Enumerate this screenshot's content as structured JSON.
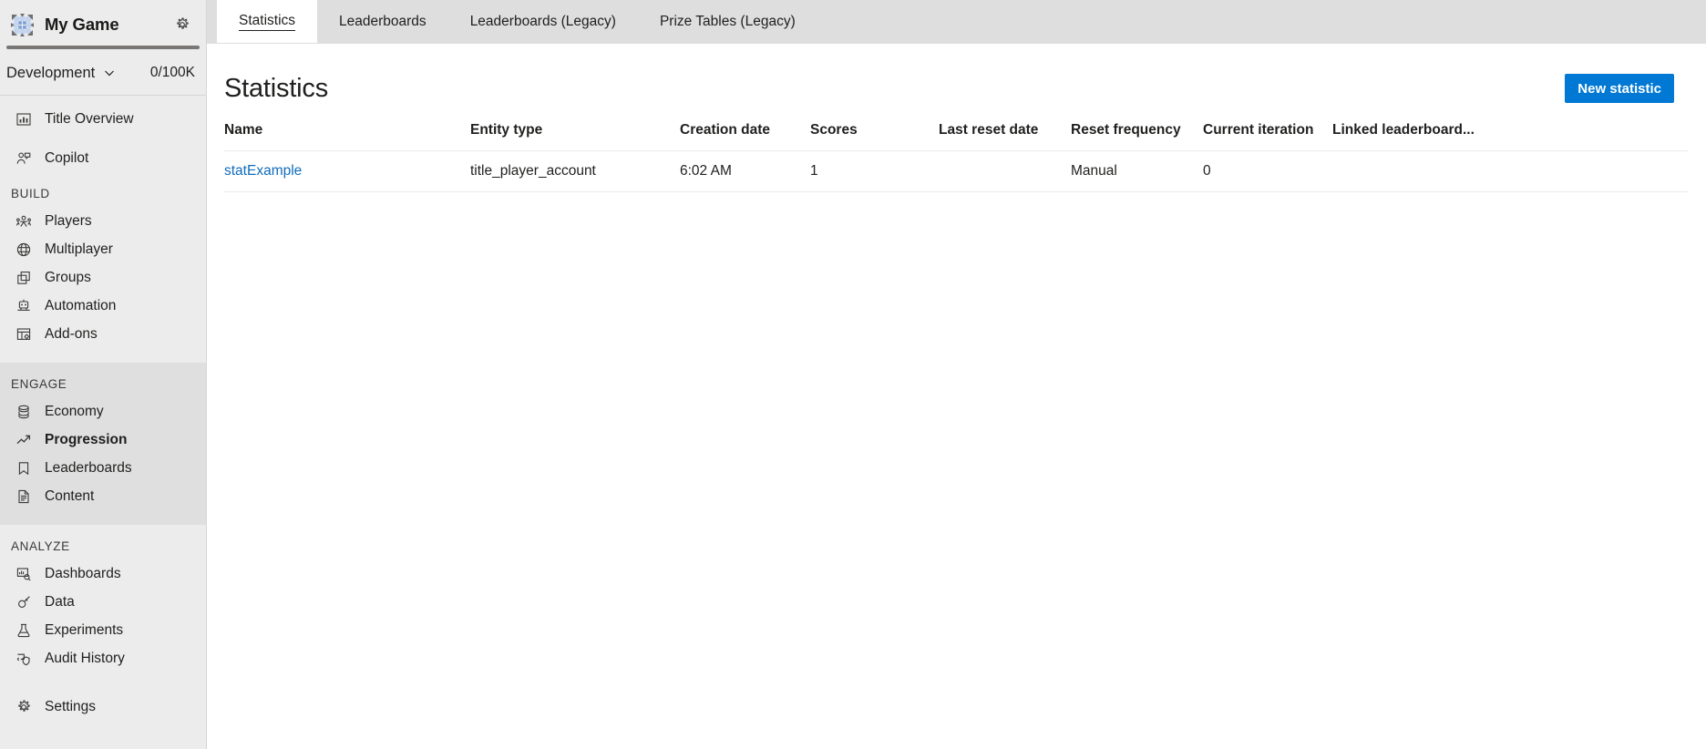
{
  "sidebar": {
    "logo_icon": "grid-logo-icon",
    "game_title": "My Game",
    "settings_icon": "gear-icon",
    "progress_percent": 0,
    "environment": {
      "name": "Development",
      "chevron_icon": "chevron-down-icon",
      "quota": "0/100K"
    },
    "top_items": [
      {
        "label": "Title Overview",
        "icon": "chart-bar-icon"
      },
      {
        "label": "Copilot",
        "icon": "copilot-person-icon"
      }
    ],
    "groups": [
      {
        "label": "BUILD",
        "highlight": false,
        "items": [
          {
            "label": "Players",
            "icon": "players-icon"
          },
          {
            "label": "Multiplayer",
            "icon": "globe-icon"
          },
          {
            "label": "Groups",
            "icon": "stacked-squares-icon"
          },
          {
            "label": "Automation",
            "icon": "robot-icon"
          },
          {
            "label": "Add-ons",
            "icon": "addons-grid-gear-icon"
          }
        ]
      },
      {
        "label": "ENGAGE",
        "highlight": true,
        "items": [
          {
            "label": "Economy",
            "icon": "coins-stack-icon"
          },
          {
            "label": "Progression",
            "icon": "trend-up-arrow-icon",
            "active": true
          },
          {
            "label": "Leaderboards",
            "icon": "bookmark-icon"
          },
          {
            "label": "Content",
            "icon": "document-icon"
          }
        ]
      },
      {
        "label": "ANALYZE",
        "highlight": false,
        "items": [
          {
            "label": "Dashboards",
            "icon": "dashboard-search-icon"
          },
          {
            "label": "Data",
            "icon": "plug-icon"
          },
          {
            "label": "Experiments",
            "icon": "flask-icon"
          },
          {
            "label": "Audit History",
            "icon": "audit-shield-icon"
          }
        ]
      }
    ],
    "bottom_items": [
      {
        "label": "Settings",
        "icon": "gear-icon"
      }
    ]
  },
  "tabs": [
    {
      "label": "Statistics",
      "active": true
    },
    {
      "label": "Leaderboards",
      "active": false
    },
    {
      "label": "Leaderboards (Legacy)",
      "active": false
    },
    {
      "label": "Prize Tables (Legacy)",
      "active": false
    }
  ],
  "page": {
    "title": "Statistics",
    "new_button_label": "New statistic"
  },
  "table": {
    "columns": [
      "Name",
      "Entity type",
      "Creation date",
      "Scores",
      "Last reset date",
      "Reset frequency",
      "Current iteration",
      "Linked leaderboard..."
    ],
    "rows": [
      {
        "name": "statExample",
        "entity_type": "title_player_account",
        "creation_date": "6:02 AM",
        "scores": "1",
        "last_reset_date": "",
        "reset_frequency": "Manual",
        "current_iteration": "0",
        "linked_leaderboard": ""
      }
    ]
  },
  "colors": {
    "accent": "#0078d4",
    "link": "#0f6cbd",
    "sidebar_bg": "#ececec",
    "sidebar_group_highlight": "#dfdfdf",
    "tabbar_bg": "#dedede",
    "text": "#201f1e"
  }
}
